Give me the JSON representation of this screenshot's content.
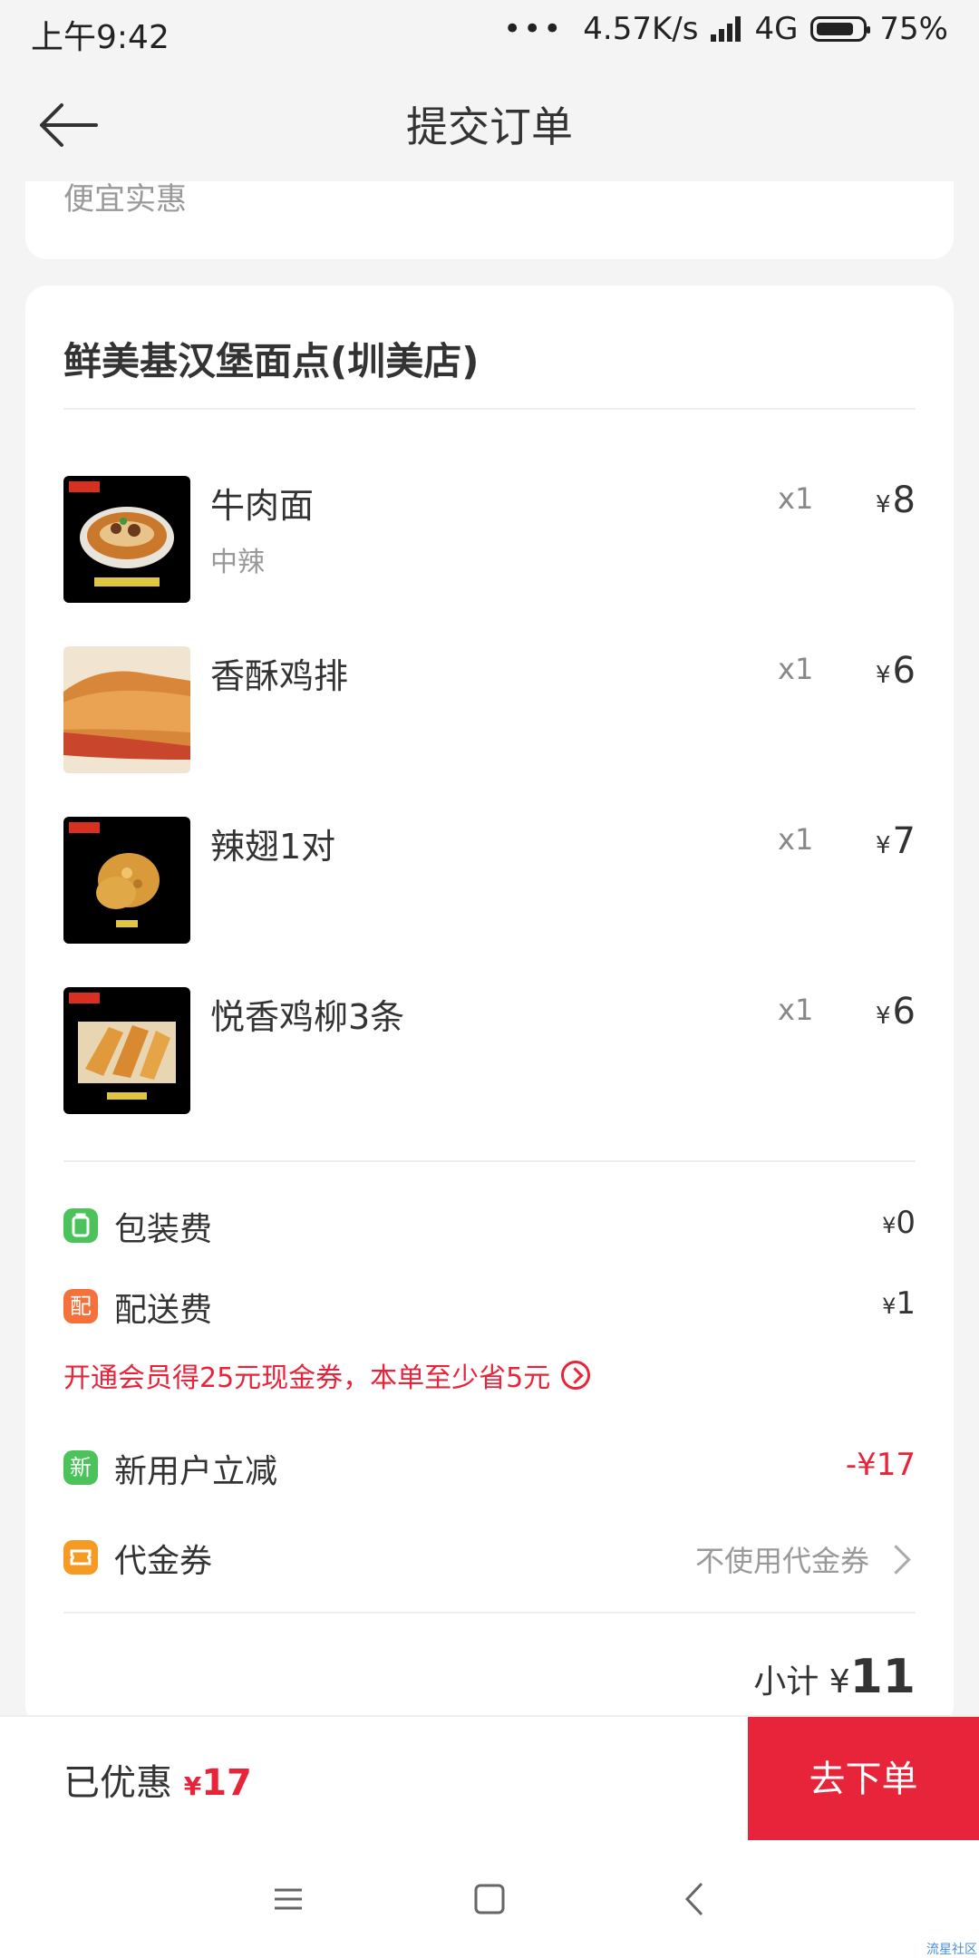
{
  "status_bar": {
    "time": "上午9:42",
    "dots": "•••",
    "speed": "4.57K/s",
    "network": "4G",
    "battery": "75%"
  },
  "header": {
    "title": "提交订单"
  },
  "top_card": {
    "partial_text": "便宜实惠"
  },
  "shop": {
    "name": "鲜美基汉堡面点(圳美店)"
  },
  "items": [
    {
      "name": "牛肉面",
      "spec": "中辣",
      "qty": "x1",
      "currency": "¥",
      "price": "8"
    },
    {
      "name": "香酥鸡排",
      "spec": "",
      "qty": "x1",
      "currency": "¥",
      "price": "6"
    },
    {
      "name": "辣翅1对",
      "spec": "",
      "qty": "x1",
      "currency": "¥",
      "price": "7"
    },
    {
      "name": "悦香鸡柳3条",
      "spec": "",
      "qty": "x1",
      "currency": "¥",
      "price": "6"
    }
  ],
  "fees": {
    "packaging": {
      "label": "包装费",
      "currency": "¥",
      "value": "0"
    },
    "delivery": {
      "label": "配送费",
      "icon_text": "配",
      "currency": "¥",
      "value": "1"
    }
  },
  "promo": {
    "text": "开通会员得25元现金券，本单至少省5元"
  },
  "discount": {
    "label": "新用户立减",
    "icon_text": "新",
    "value": "-¥17"
  },
  "voucher": {
    "label": "代金券",
    "value": "不使用代金券"
  },
  "subtotal": {
    "label": "小计",
    "currency": "¥",
    "value": "11"
  },
  "bottom_bar": {
    "saved_label": "已优惠",
    "saved_currency": "¥",
    "saved_value": "17",
    "order_button": "去下单"
  },
  "watermark": "流星社区",
  "colors": {
    "accent": "#e8243a",
    "packaging_icon": "#4cc35a",
    "delivery_icon": "#f5703a",
    "discount_icon": "#4cc35a",
    "voucher_icon": "#f59a23"
  }
}
